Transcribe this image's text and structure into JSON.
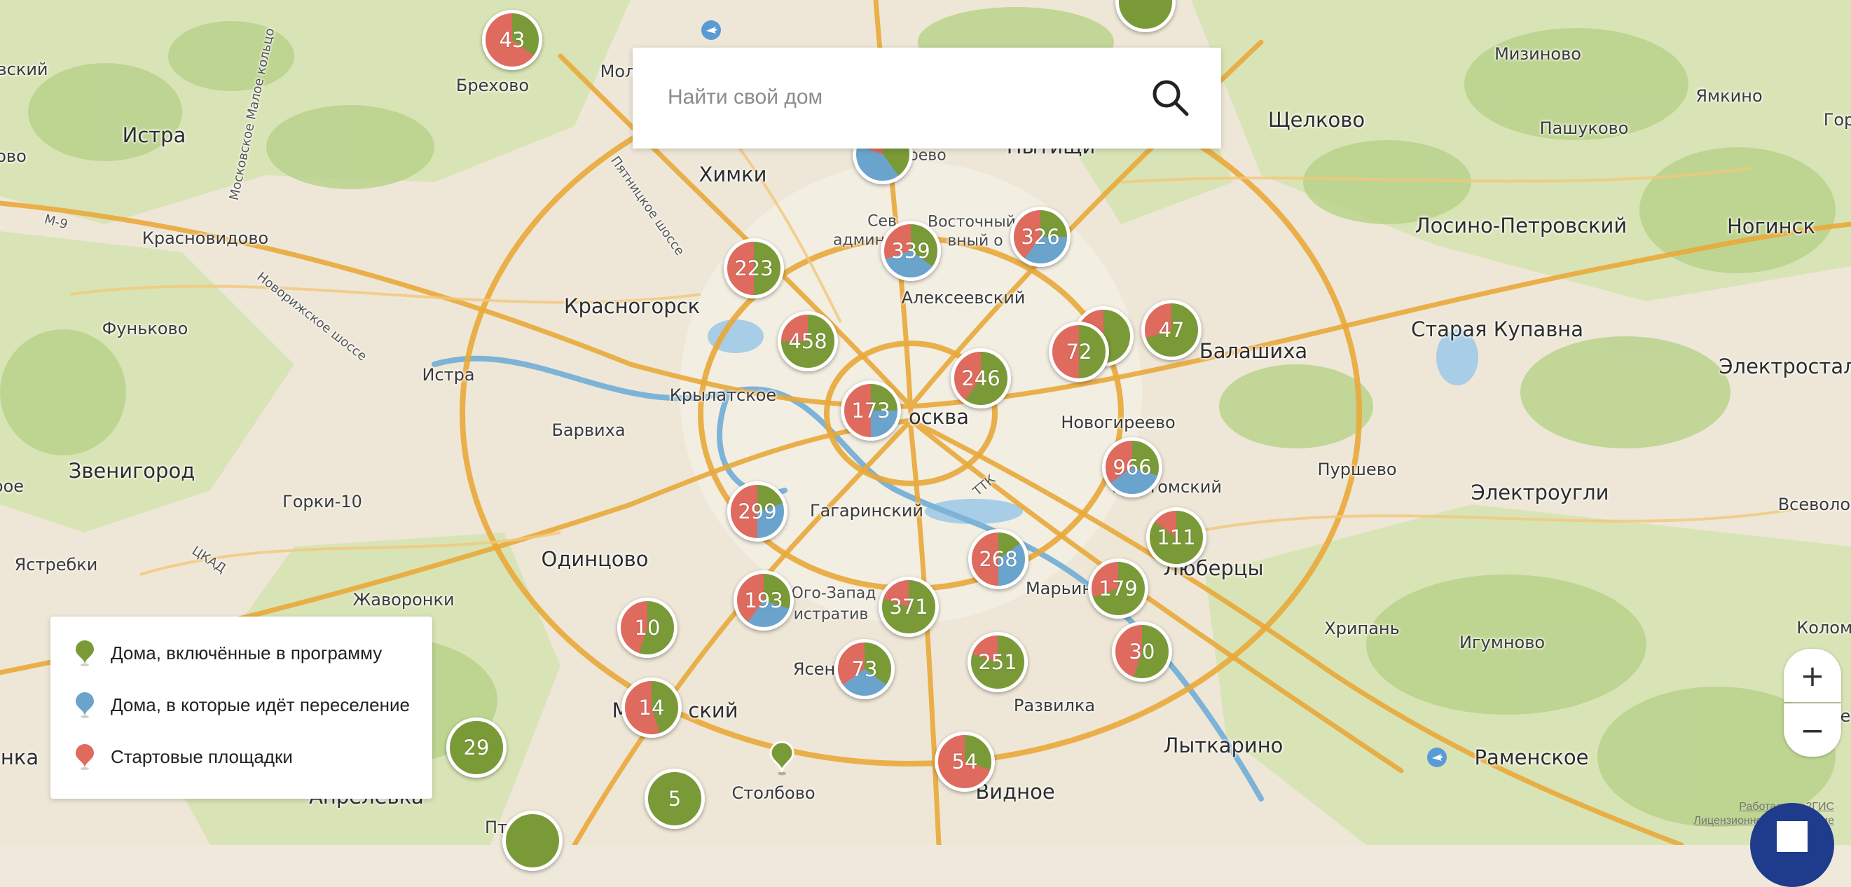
{
  "search": {
    "placeholder": "Найти свой дом"
  },
  "legend": {
    "items": [
      {
        "label": "Дома, включённые в программу",
        "color": "#7a9a37"
      },
      {
        "label": "Дома, в которые идёт переселение",
        "color": "#6aa4cc"
      },
      {
        "label": "Стартовые площадки",
        "color": "#df6a5e"
      }
    ]
  },
  "colors": {
    "green": "#7a9a37",
    "blue": "#6aa4cc",
    "red": "#df6a5e"
  },
  "places": [
    {
      "name": "Истра",
      "cls": "city"
    },
    {
      "name": "Красновидово",
      "cls": "town"
    },
    {
      "name": "Фуньково",
      "cls": "town"
    },
    {
      "name": "Истра",
      "cls": "town"
    },
    {
      "name": "Звенигород",
      "cls": "city"
    },
    {
      "name": "Горки-10",
      "cls": "town"
    },
    {
      "name": "Ястребки",
      "cls": "town"
    },
    {
      "name": "Брехово",
      "cls": "town"
    },
    {
      "name": "Красногорск",
      "cls": "city"
    },
    {
      "name": "Крылатское",
      "cls": "town"
    },
    {
      "name": "Барвиха",
      "cls": "town"
    },
    {
      "name": "Одинцово",
      "cls": "city"
    },
    {
      "name": "Жаворонки",
      "cls": "town"
    },
    {
      "name": "Химки",
      "cls": "city"
    },
    {
      "name": "Алексеевский",
      "cls": "town"
    },
    {
      "name": "осква",
      "cls": "city"
    },
    {
      "name": "Гагаринский",
      "cls": "town"
    },
    {
      "name": "Новогиреево",
      "cls": "town"
    },
    {
      "name": "Щелково",
      "cls": "city"
    },
    {
      "name": "Мизиново",
      "cls": "town"
    },
    {
      "name": "Пашуково",
      "cls": "town"
    },
    {
      "name": "Ямкино",
      "cls": "town"
    },
    {
      "name": "Лосино-Петровский",
      "cls": "city"
    },
    {
      "name": "Ногинск",
      "cls": "city"
    },
    {
      "name": "Балашиха",
      "cls": "city"
    },
    {
      "name": "Старая Купавна",
      "cls": "city"
    },
    {
      "name": "Электросталь",
      "cls": "city"
    },
    {
      "name": "Пуршево",
      "cls": "town"
    },
    {
      "name": "Электроугли",
      "cls": "city"
    },
    {
      "name": "Всеволодо",
      "cls": "town"
    },
    {
      "name": "о-Ухтомский",
      "cls": "town"
    },
    {
      "name": "Люберцы",
      "cls": "city"
    },
    {
      "name": "Хрипань",
      "cls": "town"
    },
    {
      "name": "Игумново",
      "cls": "town"
    },
    {
      "name": "Коломн",
      "cls": "town"
    },
    {
      "name": "Марьин",
      "cls": "town"
    },
    {
      "name": "Развилка",
      "cls": "town"
    },
    {
      "name": "Лыткарино",
      "cls": "city"
    },
    {
      "name": "Раменское",
      "cls": "city"
    },
    {
      "name": "Эле",
      "cls": "town"
    },
    {
      "name": "Видное",
      "cls": "city"
    },
    {
      "name": "Столбово",
      "cls": "town"
    },
    {
      "name": "М",
      "cls": "city"
    },
    {
      "name": "ский",
      "cls": "city"
    },
    {
      "name": "Апрелевка",
      "cls": "city"
    },
    {
      "name": "Ясен",
      "cls": "town"
    },
    {
      "name": "Ого-Запад",
      "cls": "small"
    },
    {
      "name": "истратив",
      "cls": "small"
    },
    {
      "name": "Сев",
      "cls": "small"
    },
    {
      "name": "Восточный",
      "cls": "small"
    },
    {
      "name": "админ",
      "cls": "small"
    },
    {
      "name": "вный о",
      "cls": "small"
    },
    {
      "name": "ерево",
      "cls": "small"
    },
    {
      "name": "Пытищи",
      "cls": "city"
    },
    {
      "name": "Мол",
      "cls": "town"
    },
    {
      "name": "вский",
      "cls": "town"
    },
    {
      "name": "ово",
      "cls": "town"
    },
    {
      "name": "оое",
      "cls": "town"
    },
    {
      "name": "нка",
      "cls": "city"
    },
    {
      "name": "Гор",
      "cls": "town"
    },
    {
      "name": "Пятницкое шоссе",
      "cls": "road"
    },
    {
      "name": "Московское Малое кольцо",
      "cls": "road"
    },
    {
      "name": "Новорижское шоссе",
      "cls": "road"
    },
    {
      "name": "ЦКАД",
      "cls": "road"
    },
    {
      "name": "М-9",
      "cls": "road"
    },
    {
      "name": "ТТК",
      "cls": "road"
    },
    {
      "name": "Пт",
      "cls": "town"
    }
  ],
  "clusters": [
    {
      "label": "43",
      "shares": [
        0.35,
        0.0,
        0.65
      ]
    },
    {
      "label": "223",
      "shares": [
        0.5,
        0.0,
        0.5
      ]
    },
    {
      "label": "339",
      "shares": [
        0.35,
        0.35,
        0.3
      ]
    },
    {
      "label": "326",
      "shares": [
        0.25,
        0.35,
        0.4
      ]
    },
    {
      "label": "458",
      "shares": [
        0.75,
        0.0,
        0.25
      ]
    },
    {
      "label": "246",
      "shares": [
        0.6,
        0.0,
        0.4
      ]
    },
    {
      "label": "47",
      "shares": [
        0.7,
        0.0,
        0.3
      ]
    },
    {
      "label": "72",
      "shares": [
        0.5,
        0.0,
        0.5
      ]
    },
    {
      "label": "173",
      "shares": [
        0.25,
        0.25,
        0.5
      ]
    },
    {
      "label": "966",
      "shares": [
        0.3,
        0.35,
        0.35
      ]
    },
    {
      "label": "299",
      "shares": [
        0.2,
        0.3,
        0.5
      ]
    },
    {
      "label": "111",
      "shares": [
        0.85,
        0.0,
        0.15
      ]
    },
    {
      "label": "268",
      "shares": [
        0.15,
        0.35,
        0.5
      ]
    },
    {
      "label": "193",
      "shares": [
        0.3,
        0.3,
        0.4
      ]
    },
    {
      "label": "371",
      "shares": [
        0.8,
        0.0,
        0.2
      ]
    },
    {
      "label": "179",
      "shares": [
        0.7,
        0.0,
        0.3
      ]
    },
    {
      "label": "10",
      "shares": [
        0.55,
        0.0,
        0.45
      ]
    },
    {
      "label": "73",
      "shares": [
        0.35,
        0.3,
        0.35
      ]
    },
    {
      "label": "251",
      "shares": [
        0.8,
        0.0,
        0.2
      ]
    },
    {
      "label": "30",
      "shares": [
        0.55,
        0.0,
        0.45
      ]
    },
    {
      "label": "14",
      "shares": [
        0.45,
        0.0,
        0.55
      ]
    },
    {
      "label": "29",
      "shares": [
        1.0,
        0.0,
        0.0
      ]
    },
    {
      "label": "54",
      "shares": [
        0.3,
        0.0,
        0.7
      ]
    },
    {
      "label": "5",
      "shares": [
        1.0,
        0.0,
        0.0
      ]
    }
  ],
  "controls": {
    "zoom_in": "+",
    "zoom_out": "−"
  },
  "attribution": {
    "line1": "Работает на 2ГИС",
    "line2": "Лицензионное соглашение"
  }
}
